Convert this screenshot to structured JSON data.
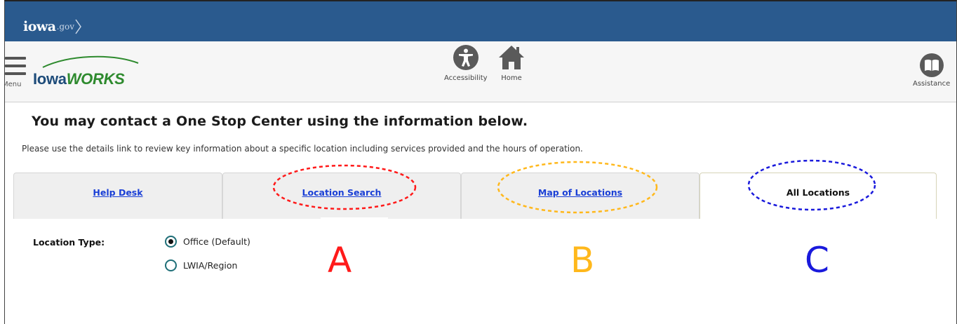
{
  "gov": {
    "logo_main": "iowa",
    "logo_suffix": ".gov"
  },
  "header": {
    "menu_label": "Menu",
    "brand_part1": "Iowa",
    "brand_part2": "WORKS",
    "accessibility_label": "Accessibility",
    "home_label": "Home",
    "assistance_label": "Assistance"
  },
  "content": {
    "heading": "You may contact a One Stop Center using the information below.",
    "subtext": "Please use the details link to review key information about a specific location including services provided and the hours of operation."
  },
  "tabs": [
    {
      "label": "Help Desk",
      "active": false
    },
    {
      "label": "Location Search",
      "active": false
    },
    {
      "label": "Map of Locations",
      "active": false
    },
    {
      "label": "All Locations",
      "active": true
    }
  ],
  "location_type": {
    "label": "Location Type:",
    "options": [
      {
        "label": "Office (Default)",
        "checked": true
      },
      {
        "label": "LWIA/Region",
        "checked": false
      }
    ]
  },
  "annotations": {
    "letters": [
      "A",
      "B",
      "C"
    ],
    "colors": {
      "A": "#ff1a1a",
      "B": "#ffb81c",
      "C": "#1a1adc"
    }
  }
}
